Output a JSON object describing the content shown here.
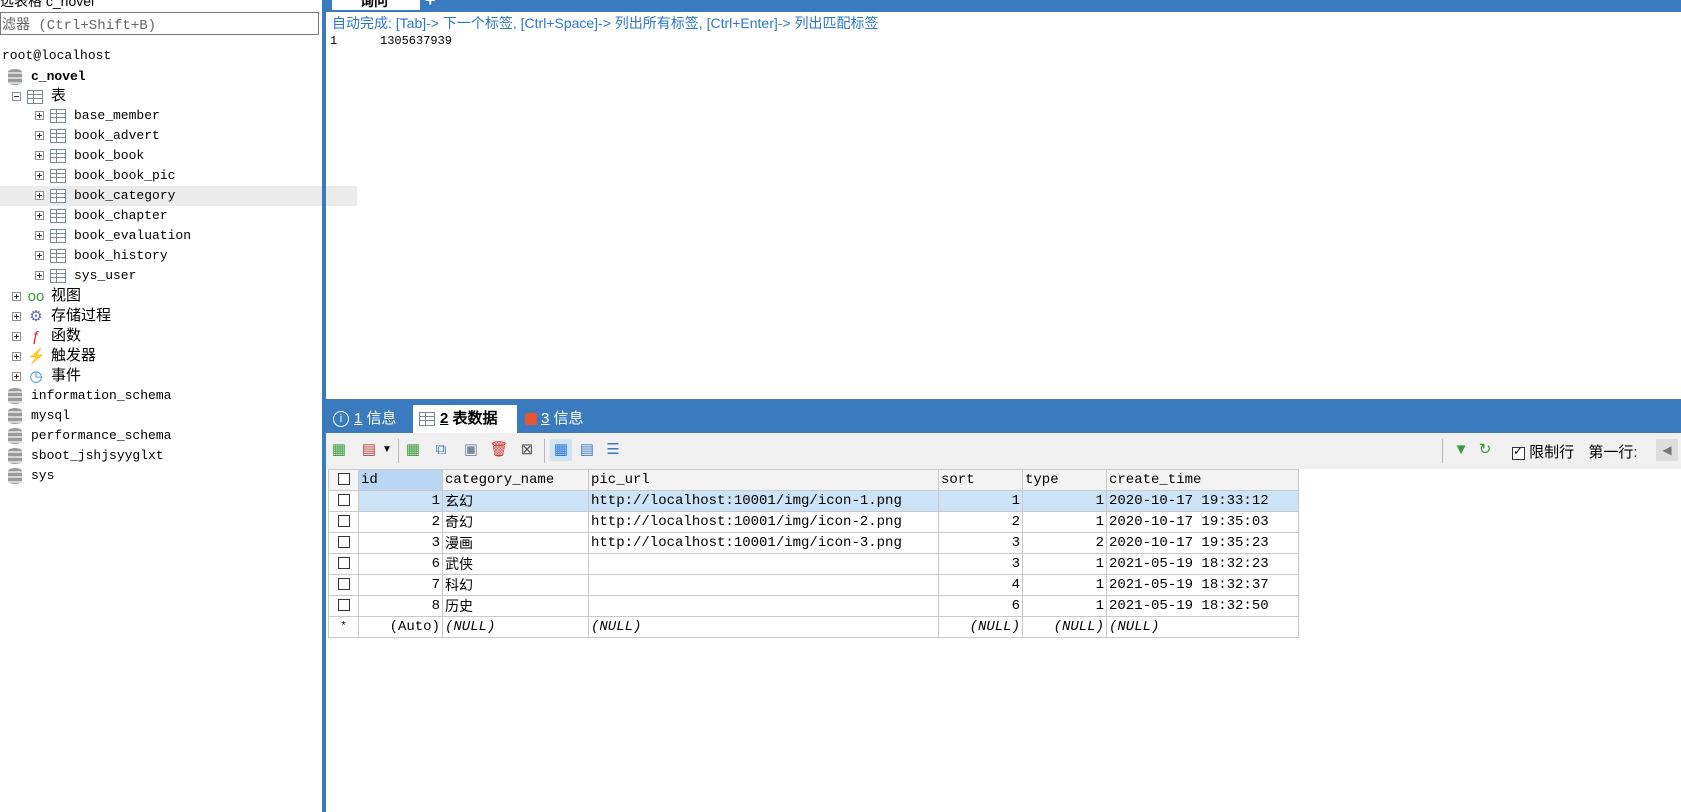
{
  "left": {
    "title": "选表格 c_novel",
    "filter_placeholder": "滤器 (Ctrl+Shift+B)",
    "connection": "root@localhost",
    "database": "c_novel",
    "tables_folder": "表",
    "tables": [
      "base_member",
      "book_advert",
      "book_book",
      "book_book_pic",
      "book_category",
      "book_chapter",
      "book_evaluation",
      "book_history",
      "sys_user"
    ],
    "selected_table": "book_category",
    "folders": [
      {
        "label": "视图",
        "icon": "glasses-icon"
      },
      {
        "label": "存储过程",
        "icon": "gear-icon"
      },
      {
        "label": "函数",
        "icon": "function-icon"
      },
      {
        "label": "触发器",
        "icon": "lightning-icon"
      },
      {
        "label": "事件",
        "icon": "clock-icon"
      }
    ],
    "other_databases": [
      "information_schema",
      "mysql",
      "performance_schema",
      "sboot_jshjsyyglxt",
      "sys"
    ]
  },
  "editor": {
    "tab_label": "询问",
    "plus": "+",
    "autocomplete_hint": "自动完成: [Tab]-> 下一个标签, [Ctrl+Space]-> 列出所有标签, [Ctrl+Enter]-> 列出匹配标签",
    "line_no": "1",
    "line_text": "1305637939"
  },
  "result_tabs": [
    {
      "num": "1",
      "label": "信息"
    },
    {
      "num": "2",
      "label": "表数据"
    },
    {
      "num": "3",
      "label": "信息"
    }
  ],
  "toolbar": {
    "limit_label": "限制行",
    "first_row_label": "第一行:"
  },
  "grid": {
    "columns": [
      "id",
      "category_name",
      "pic_url",
      "sort",
      "type",
      "create_time"
    ],
    "rows": [
      [
        "1",
        "玄幻",
        "http://localhost:10001/img/icon-1.png",
        "1",
        "1",
        "2020-10-17 19:33:12"
      ],
      [
        "2",
        "奇幻",
        "http://localhost:10001/img/icon-2.png",
        "2",
        "1",
        "2020-10-17 19:35:03"
      ],
      [
        "3",
        "漫画",
        "http://localhost:10001/img/icon-3.png",
        "3",
        "2",
        "2020-10-17 19:35:23"
      ],
      [
        "6",
        "武侠",
        "",
        "3",
        "1",
        "2021-05-19 18:32:23"
      ],
      [
        "7",
        "科幻",
        "",
        "4",
        "1",
        "2021-05-19 18:32:37"
      ],
      [
        "8",
        "历史",
        "",
        "6",
        "1",
        "2021-05-19 18:32:50"
      ]
    ],
    "new_row": [
      "*",
      "(Auto)",
      "(NULL)",
      "(NULL)",
      "(NULL)",
      "(NULL)",
      "(NULL)"
    ]
  },
  "colors": {
    "accent": "#3a7bbf",
    "link": "#2a75d8",
    "selected_row": "#cde3f7"
  }
}
